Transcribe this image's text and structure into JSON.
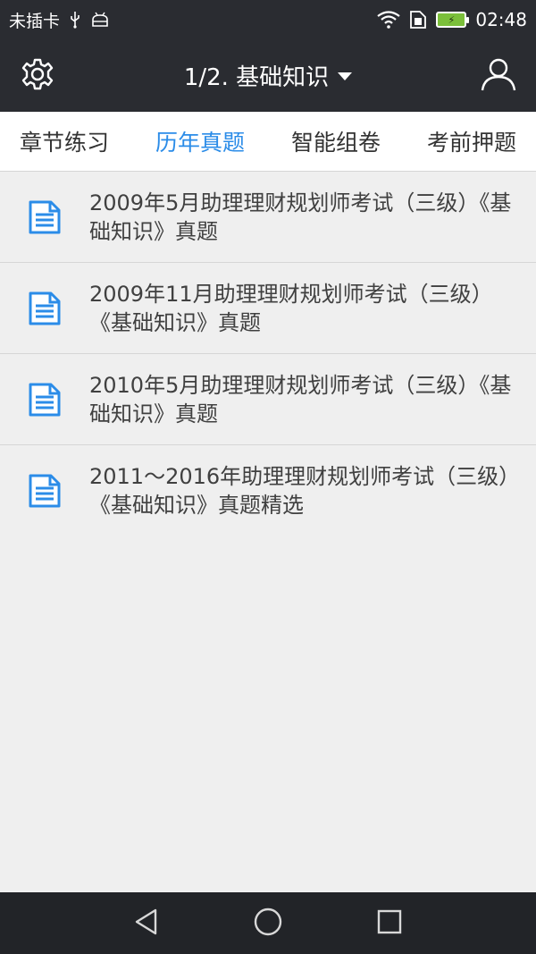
{
  "status_bar": {
    "carrier": "未插卡",
    "time": "02:48"
  },
  "header": {
    "title": "1/2. 基础知识",
    "settings_icon": "gear-icon",
    "profile_icon": "user-icon"
  },
  "tabs": [
    {
      "label": "章节练习",
      "active": false
    },
    {
      "label": "历年真题",
      "active": true
    },
    {
      "label": "智能组卷",
      "active": false
    },
    {
      "label": "考前押题",
      "active": false
    }
  ],
  "list": {
    "items": [
      {
        "title": "2009年5月助理理财规划师考试（三级）《基础知识》真题"
      },
      {
        "title": "2009年11月助理理财规划师考试（三级）《基础知识》真题"
      },
      {
        "title": "2010年5月助理理财规划师考试（三级）《基础知识》真题"
      },
      {
        "title": "2011～2016年助理理财规划师考试（三级）《基础知识》真题精选"
      }
    ],
    "icon": "document-icon"
  },
  "nav_bar": {
    "back_icon": "back-triangle-icon",
    "home_icon": "home-circle-icon",
    "recent_icon": "recent-square-icon"
  },
  "colors": {
    "header_bg": "#2a2c31",
    "accent": "#2b8ce8",
    "list_bg": "#efefef"
  }
}
